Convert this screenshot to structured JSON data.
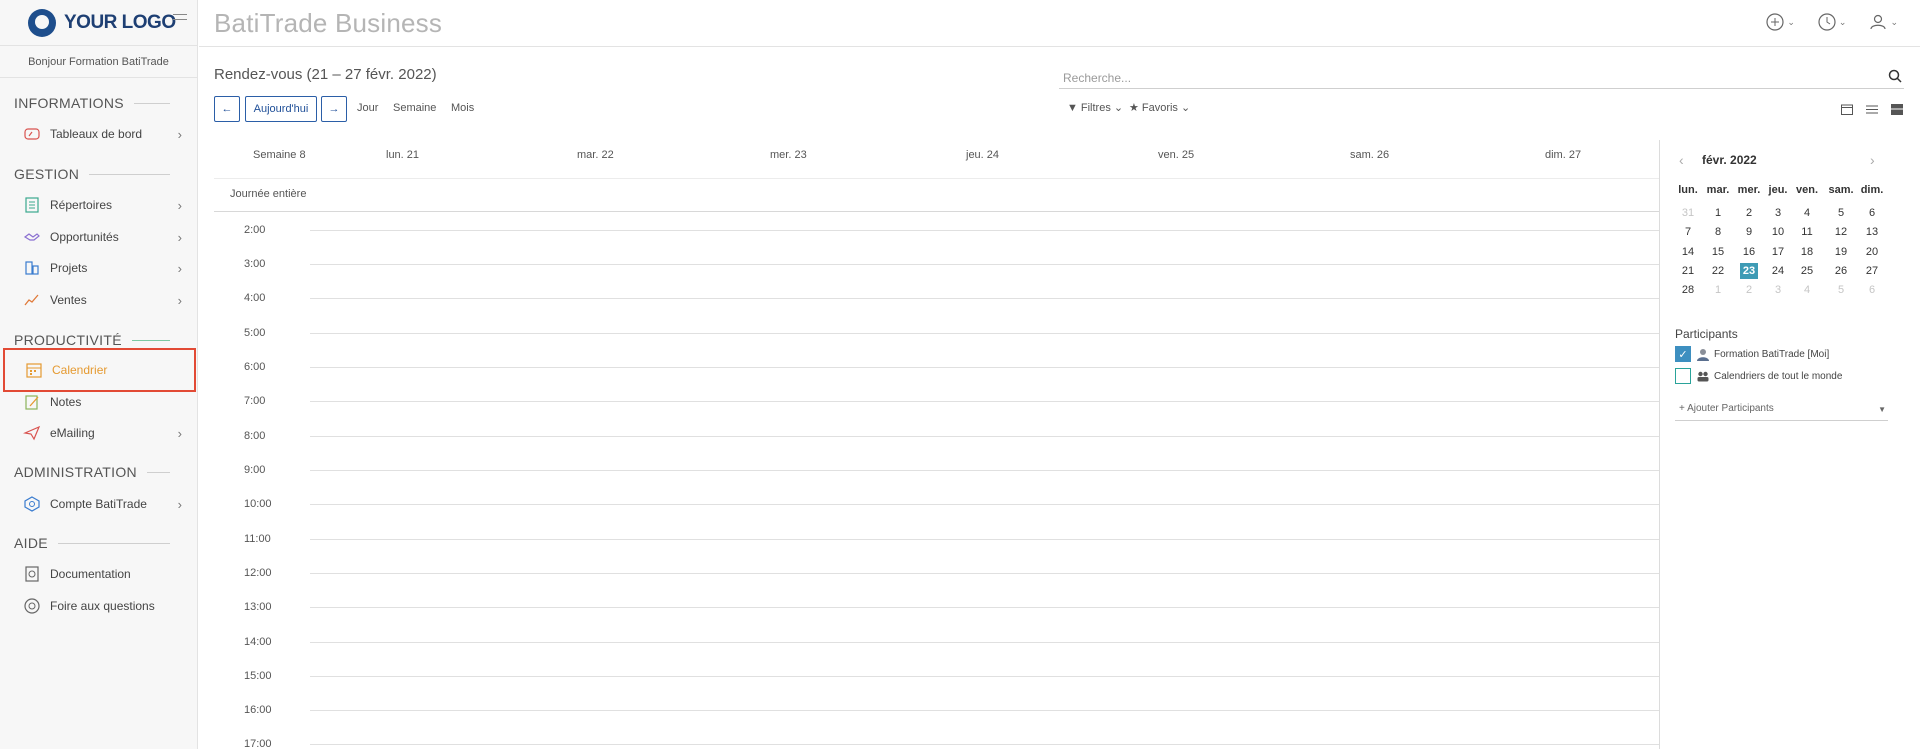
{
  "sidebar": {
    "logo_text": "YOUR LOGO",
    "greeting": "Bonjour Formation BatiTrade",
    "sections": [
      {
        "title": "INFORMATIONS"
      },
      {
        "title": "GESTION"
      },
      {
        "title": "PRODUCTIVITÉ"
      },
      {
        "title": "ADMINISTRATION"
      },
      {
        "title": "AIDE"
      }
    ],
    "items": [
      {
        "label": "Tableaux de bord",
        "icon": "dashboard-icon"
      },
      {
        "label": "Répertoires",
        "icon": "directory-icon"
      },
      {
        "label": "Opportunités",
        "icon": "handshake-icon"
      },
      {
        "label": "Projets",
        "icon": "projects-icon"
      },
      {
        "label": "Ventes",
        "icon": "sales-chart-icon"
      },
      {
        "label": "Calendrier",
        "icon": "calendar-icon"
      },
      {
        "label": "Notes",
        "icon": "notes-icon"
      },
      {
        "label": "eMailing",
        "icon": "paper-plane-icon"
      },
      {
        "label": "Compte BatiTrade",
        "icon": "account-cube-icon"
      },
      {
        "label": "Documentation",
        "icon": "documentation-icon"
      },
      {
        "label": "Foire aux questions",
        "icon": "faq-icon"
      }
    ]
  },
  "topbar": {
    "title": "BatiTrade Business",
    "icons": [
      "add-circle-icon",
      "clock-icon",
      "user-icon"
    ]
  },
  "control_panel": {
    "title": "Rendez-vous (21 – 27 févr. 2022)",
    "search_placeholder": "Recherche...",
    "today_label": "Aujourd'hui",
    "views": [
      "Jour",
      "Semaine",
      "Mois"
    ],
    "filters_label": "Filtres",
    "favorites_label": "Favoris"
  },
  "calendar": {
    "week_label": "Semaine 8",
    "days": [
      "lun. 21",
      "mar. 22",
      "mer. 23",
      "jeu. 24",
      "ven. 25",
      "sam. 26",
      "dim. 27"
    ],
    "all_day_label": "Journée entière",
    "hours": [
      "2:00",
      "3:00",
      "4:00",
      "5:00",
      "6:00",
      "7:00",
      "8:00",
      "9:00",
      "10:00",
      "11:00",
      "12:00",
      "13:00",
      "14:00",
      "15:00",
      "16:00",
      "17:00"
    ]
  },
  "mini_calendar": {
    "month_label": "févr. 2022",
    "weekday_headers": [
      "lun.",
      "mar.",
      "mer.",
      "jeu.",
      "ven.",
      "sam.",
      "dim."
    ],
    "weeks": [
      [
        "31",
        "1",
        "2",
        "3",
        "4",
        "5",
        "6"
      ],
      [
        "7",
        "8",
        "9",
        "10",
        "11",
        "12",
        "13"
      ],
      [
        "14",
        "15",
        "16",
        "17",
        "18",
        "19",
        "20"
      ],
      [
        "21",
        "22",
        "23",
        "24",
        "25",
        "26",
        "27"
      ],
      [
        "28",
        "1",
        "2",
        "3",
        "4",
        "5",
        "6"
      ]
    ],
    "today": "23"
  },
  "participants": {
    "title": "Participants",
    "items": [
      {
        "label": "Formation BatiTrade [Moi]",
        "checked": true
      },
      {
        "label": "Calendriers de tout le monde",
        "checked": false
      }
    ],
    "add_label": "+ Ajouter Participants"
  },
  "colors": {
    "brand": "#1e3f73",
    "active_item": "#e59a31",
    "highlight_border": "#e24a35",
    "today_bg": "#3e9bb5",
    "nav_button": "#2b5ea7"
  }
}
